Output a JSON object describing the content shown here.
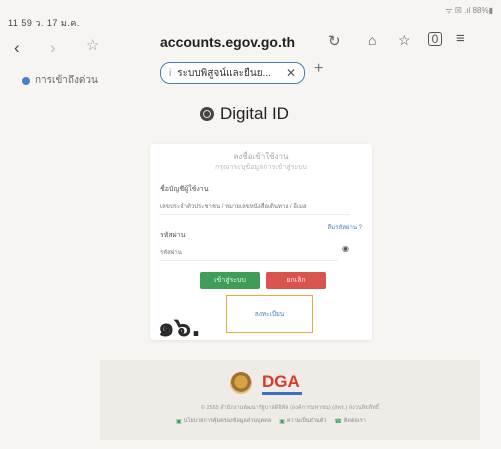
{
  "status_bar": {
    "time": "11 59  ว. 17 ม.ค.",
    "right": "ᯤ ☒ .ıl 88%▮"
  },
  "browser": {
    "url": "accounts.egov.go.th",
    "tab_title": "ระบบพิสูจน์และยืนย...",
    "tab_info": "i",
    "quick_link": "การเข้าถึงด่วน",
    "icons": [
      "back-icon",
      "forward-icon",
      "star-icon",
      "reload-icon",
      "home-icon",
      "bookmark-icon",
      "tabs-icon",
      "menu-icon",
      "close-icon",
      "plus-icon"
    ],
    "tab_count": "0"
  },
  "brand": {
    "name": "Digital ID",
    "icon": "fingerprint-icon"
  },
  "login": {
    "title": "ลงชื่อเข้าใช้งาน",
    "subtitle": "กรุณาระบุข้อมูลการเข้าสู่ระบบ",
    "username_label": "ชื่อบัญชีผู้ใช้งาน",
    "username_placeholder": "เลขประจำตัวประชาชน / หมายเลขหนังสือเดินทาง / อีเมล",
    "forgot_password": "ลืมรหัสผ่าน ?",
    "password_label": "รหัสผ่าน",
    "password_placeholder": "รหัสผ่าน",
    "login_button": "เข้าสู่ระบบ",
    "cancel_button": "ยกเลิก",
    "register_link": "ลงทะเบียน"
  },
  "annotation": {
    "handwritten_number": "๑๖."
  },
  "footer": {
    "logo_text": "DGA",
    "copyright": "© 2565 สำนักงานพัฒนารัฐบาลดิจิทัล (องค์การมหาชน) (สพร.) สงวนลิขสิทธิ์",
    "links": [
      "นโยบายการคุ้มครองข้อมูลส่วนบุคคล",
      "ความเป็นส่วนตัว",
      "ติดต่อเรา"
    ]
  },
  "colors": {
    "accent_blue": "#4a7fc0",
    "login_green": "#3e9e57",
    "cancel_red": "#d9534f",
    "highlight_orange": "#f0a640",
    "dga_red": "#d93a2b"
  }
}
